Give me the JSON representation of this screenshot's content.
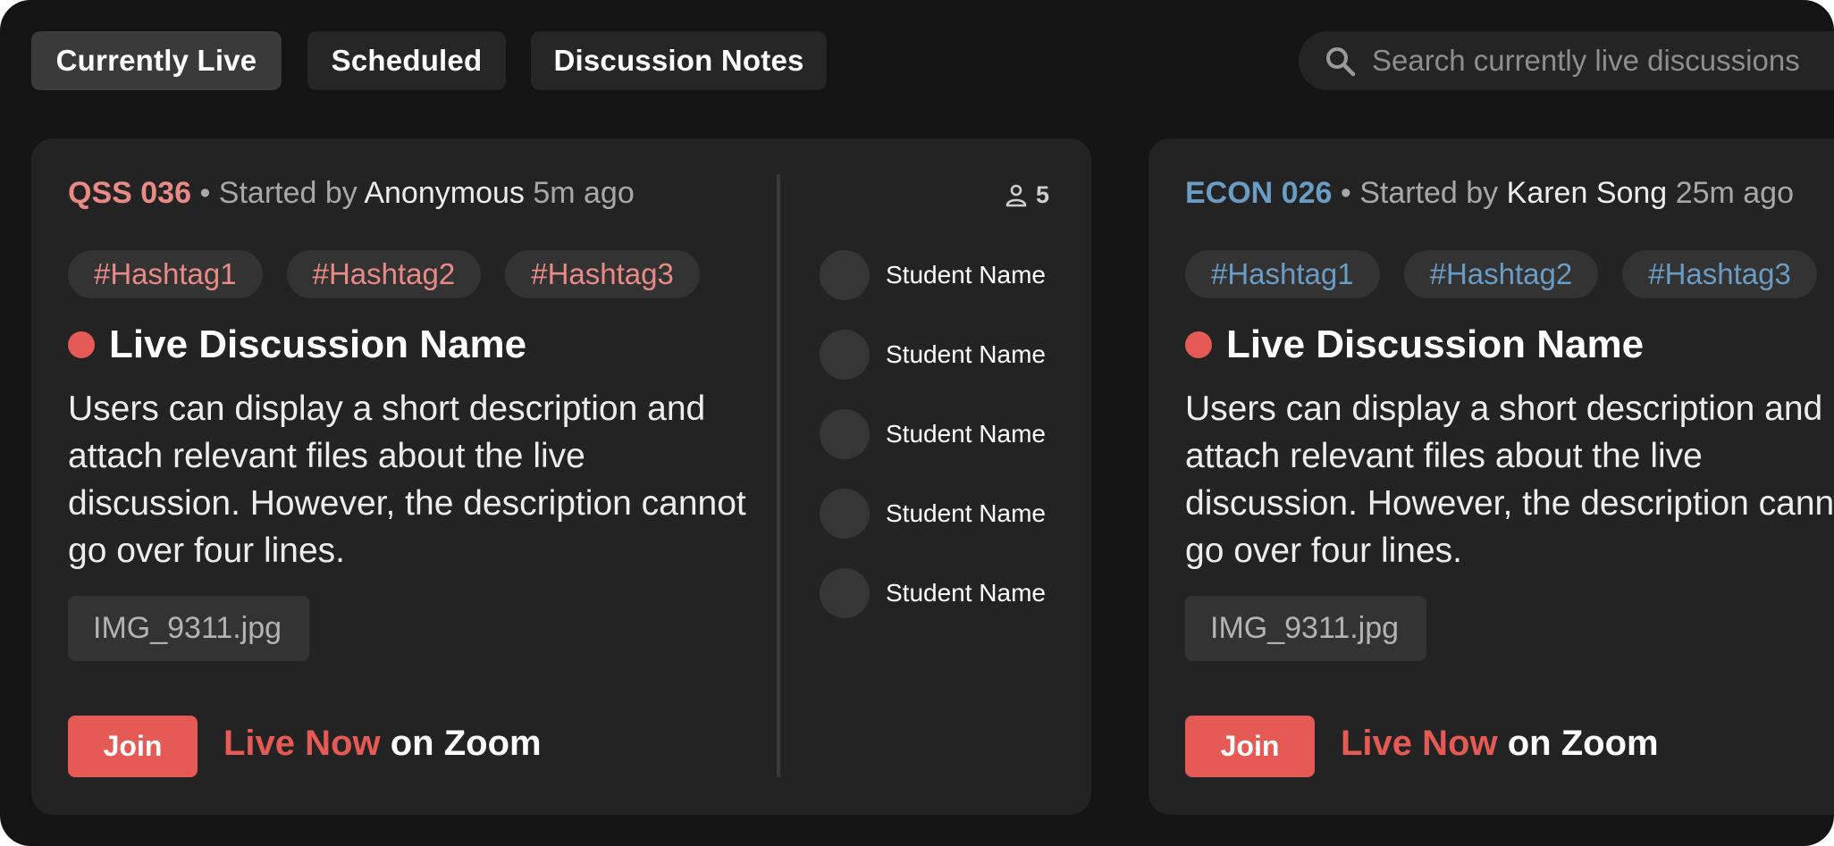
{
  "tabs": [
    {
      "label": "Currently Live",
      "active": true
    },
    {
      "label": "Scheduled",
      "active": false
    },
    {
      "label": "Discussion Notes",
      "active": false
    }
  ],
  "search": {
    "placeholder": "Search currently live discussions",
    "icon": "search-icon"
  },
  "colors": {
    "live": "#e65a55",
    "course_qss": "#ea8a85",
    "course_econ": "#6a9cc4"
  },
  "cards": [
    {
      "course": "QSS 036",
      "started_by_prefix": "• Started by",
      "author": "Anonymous",
      "time_ago": "5m ago",
      "tags": [
        "#Hashtag1",
        "#Hashtag2",
        "#Hashtag3"
      ],
      "title": "Live Discussion Name",
      "description": "Users can display a short description and attach relevant files about the live discussion. However, the description cannot go over four lines.",
      "file": "IMG_9311.jpg",
      "join_label": "Join",
      "live_now": "Live Now",
      "on_platform": "on Zoom",
      "attendee_count": "5",
      "students": [
        "Student Name",
        "Student Name",
        "Student Name",
        "Student Name",
        "Student Name"
      ]
    },
    {
      "course": "ECON 026",
      "started_by_prefix": "• Started by",
      "author": "Karen Song",
      "time_ago": "25m ago",
      "tags": [
        "#Hashtag1",
        "#Hashtag2",
        "#Hashtag3"
      ],
      "title": "Live Discussion Name",
      "description": "Users can display a short description and attach relevant files about the live discussion. However, the description cannot go over four lines.",
      "file": "IMG_9311.jpg",
      "join_label": "Join",
      "live_now": "Live Now",
      "on_platform": "on Zoom"
    }
  ]
}
